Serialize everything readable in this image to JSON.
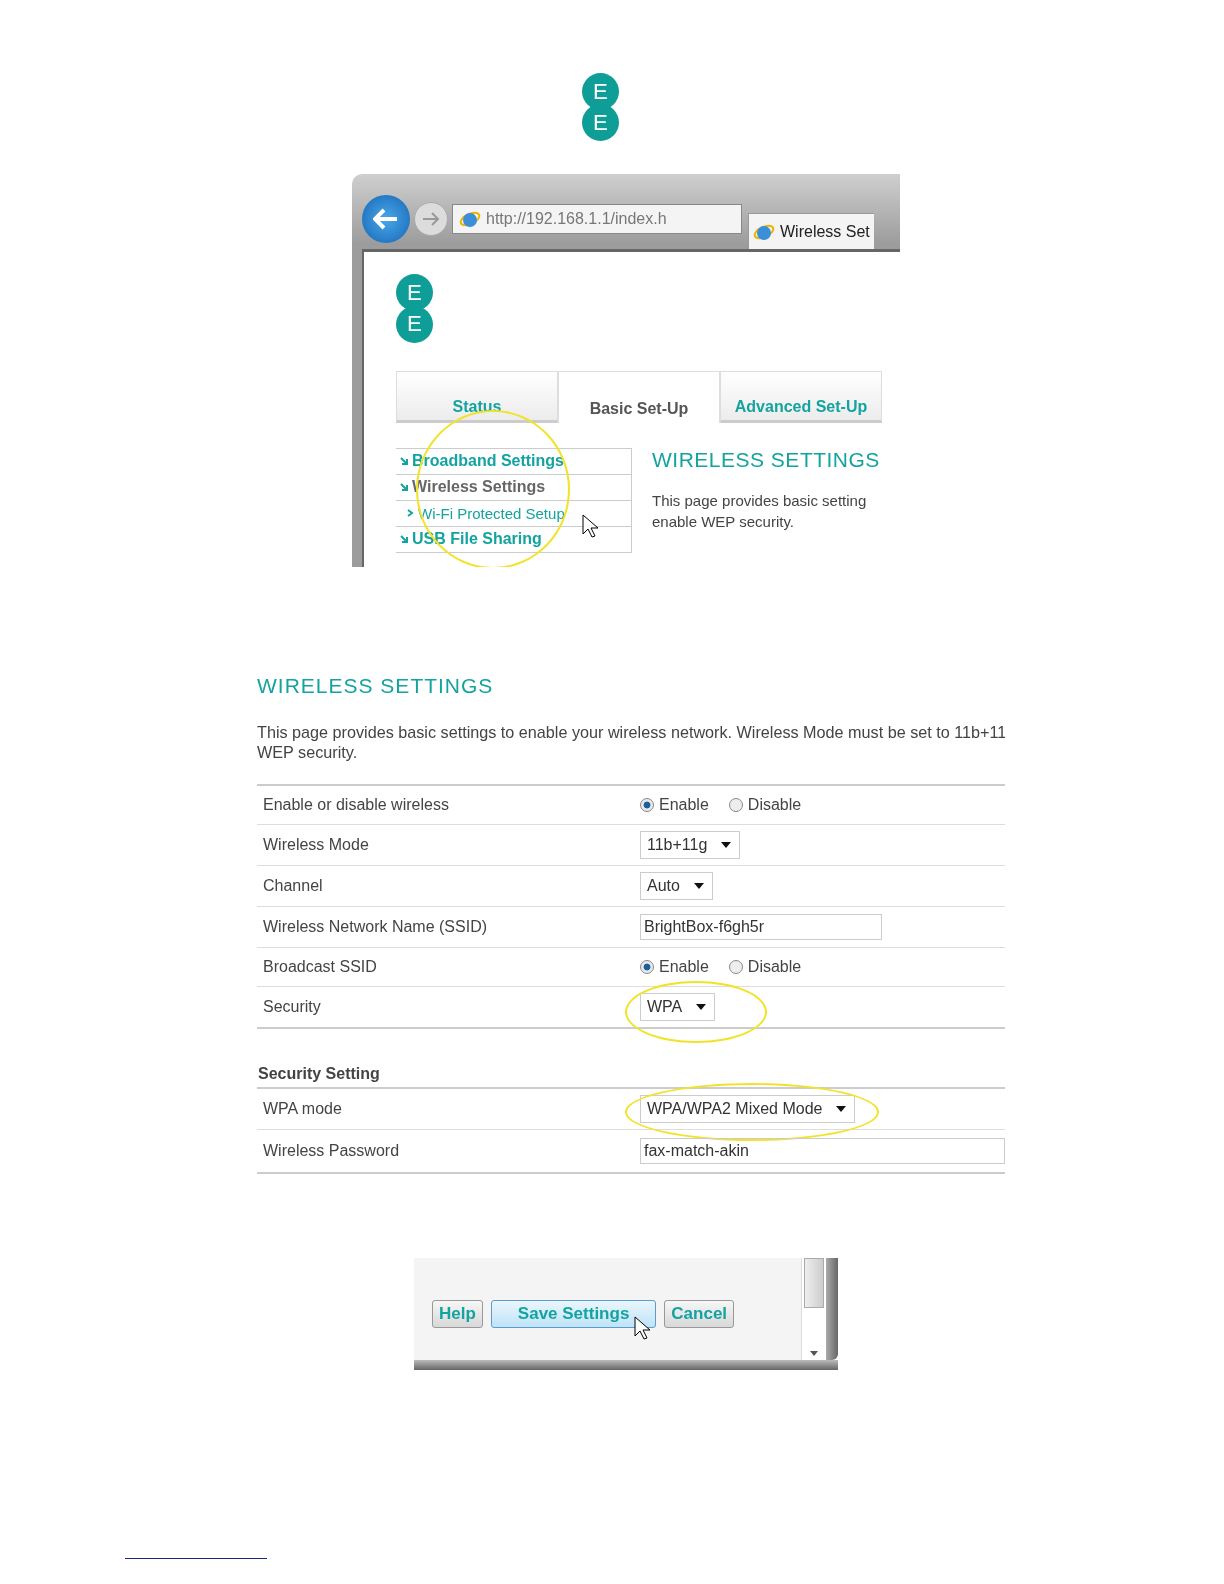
{
  "page_logo": {
    "letters": [
      "E",
      "E"
    ]
  },
  "browser": {
    "address": "http://192.168.1.1/index.h",
    "tab_title": "Wireless Set",
    "site_logo": [
      "E",
      "E"
    ],
    "tabs": [
      {
        "label": "Status",
        "selected": false
      },
      {
        "label": "Basic Set-Up",
        "selected": true
      },
      {
        "label": "Advanced Set-Up",
        "selected": false
      }
    ],
    "sidebar": {
      "highlighted": true,
      "items": [
        {
          "label": "Broadband Settings",
          "selected": false
        },
        {
          "label": "Wireless Settings",
          "selected": true,
          "children": [
            {
              "label": "Wi-Fi Protected Setup",
              "selected": false
            }
          ]
        },
        {
          "label": "USB File Sharing",
          "selected": false
        }
      ]
    },
    "heading": "WIRELESS SETTINGS",
    "intro": [
      "This page provides basic setting",
      "enable WEP security."
    ]
  },
  "settings": {
    "heading": "WIRELESS SETTINGS",
    "intro": [
      "This page provides basic settings to enable your wireless network. Wireless Mode must be set to 11b+11",
      "WEP security."
    ],
    "rows": [
      {
        "label": "Enable or disable wireless",
        "kind": "radio",
        "options": [
          {
            "label": "Enable",
            "selected": true
          },
          {
            "label": "Disable",
            "selected": false
          }
        ],
        "highlighted": false
      },
      {
        "label": "Wireless Mode",
        "kind": "select",
        "value": "11b+11g",
        "highlighted": false
      },
      {
        "label": "Channel",
        "kind": "select",
        "value": "Auto",
        "highlighted": false
      },
      {
        "label": "Wireless Network Name (SSID)",
        "kind": "text",
        "value": "BrightBox-f6gh5r",
        "highlighted": false
      },
      {
        "label": "Broadcast SSID",
        "kind": "radio",
        "options": [
          {
            "label": "Enable",
            "selected": true
          },
          {
            "label": "Disable",
            "selected": false
          }
        ],
        "highlighted": false
      },
      {
        "label": "Security",
        "kind": "select",
        "value": "WPA",
        "highlighted": true
      }
    ],
    "section": {
      "title": "Security Setting",
      "rows": [
        {
          "label": "WPA mode",
          "kind": "select",
          "value": "WPA/WPA2 Mixed Mode",
          "highlighted": true
        },
        {
          "label": "Wireless Password",
          "kind": "text",
          "value": "fax-match-akin",
          "highlighted": false
        }
      ]
    }
  },
  "buttons": [
    {
      "label": "Help",
      "hovered": false
    },
    {
      "label": "Save Settings",
      "hovered": true
    },
    {
      "label": "Cancel",
      "hovered": false
    }
  ]
}
